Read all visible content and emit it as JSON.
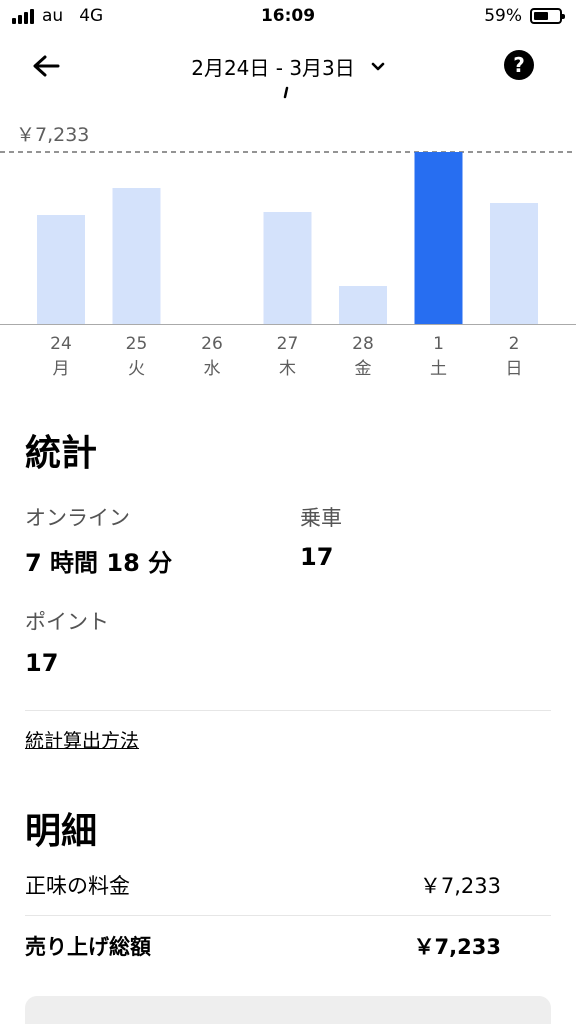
{
  "status_bar": {
    "carrier": "au",
    "network": "4G",
    "time": "16:09",
    "battery_percent": "59%",
    "battery_level": 0.59
  },
  "header": {
    "date_range": "2月24日 - 3月3日",
    "back_icon": "back-arrow-icon",
    "dropdown_icon": "chevron-down-icon",
    "help_icon": "help-icon"
  },
  "chart_data": {
    "type": "bar",
    "title": "",
    "y_max_label": "￥7,233",
    "ylim": [
      0,
      7233
    ],
    "categories": [
      {
        "day": "24",
        "weekday": "月"
      },
      {
        "day": "25",
        "weekday": "火"
      },
      {
        "day": "26",
        "weekday": "水"
      },
      {
        "day": "27",
        "weekday": "木"
      },
      {
        "day": "28",
        "weekday": "金"
      },
      {
        "day": "1",
        "weekday": "土"
      },
      {
        "day": "2",
        "weekday": "日"
      }
    ],
    "values": [
      4600,
      5700,
      0,
      4700,
      1600,
      7233,
      5100
    ],
    "selected_index": 5,
    "colors": {
      "bar": "#d4e2fb",
      "selected": "#276ef1",
      "baseline": "#aaaaaa",
      "dashed": "#555555"
    }
  },
  "stats": {
    "title": "統計",
    "online_label": "オンライン",
    "online_value": "7 時間 18 分",
    "rides_label": "乗車",
    "rides_value": "17",
    "points_label": "ポイント",
    "points_value": "17",
    "method_link": "統計算出方法"
  },
  "details": {
    "title": "明細",
    "net_fare_label": "正味の料金",
    "net_fare_value": "￥7,233",
    "total_label": "売り上げ総額",
    "total_value": "￥7,233"
  }
}
